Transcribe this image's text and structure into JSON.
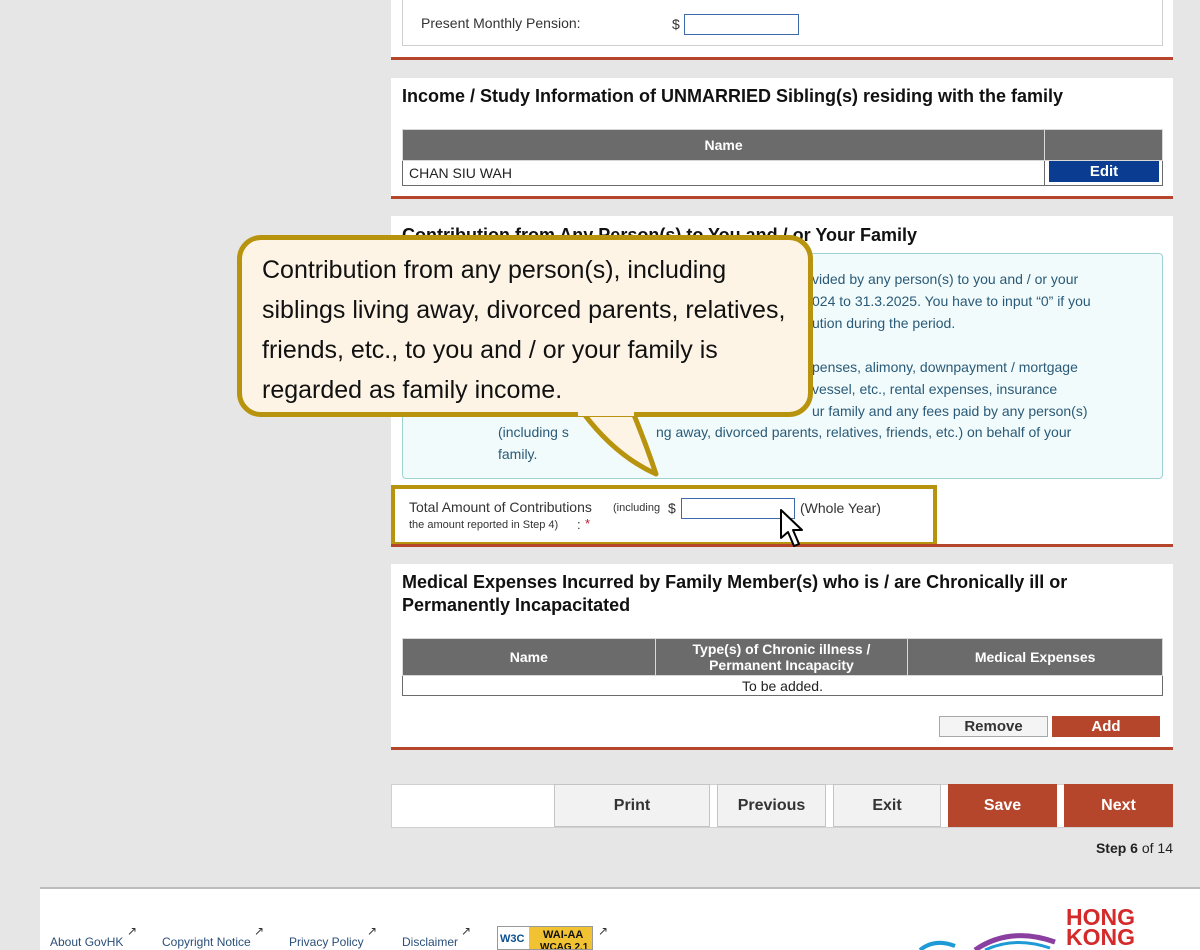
{
  "pension": {
    "label": "Present Monthly Pension:",
    "currency": "$",
    "value": ""
  },
  "siblings": {
    "title": "Income / Study Information of UNMARRIED Sibling(s) residing with the family",
    "col_name": "Name",
    "rows": [
      {
        "name": "CHAN SIU WAH",
        "edit_label": "Edit"
      }
    ]
  },
  "contribution": {
    "title": "Contribution from Any Person(s) to You and / or Your Family",
    "info_lines_right": [
      "vided by any person(s) to you and / or your",
      "024 to 31.3.2025. You have to input “0” if you",
      "ution during the period."
    ],
    "info_lines_right2": [
      "penses, alimony, downpayment / mortgage",
      " vessel, etc., rental expenses, insurance",
      "ur family and any fees paid by any person(s)"
    ],
    "info_line_a_left": "(including s",
    "info_line_a_right": "ng away, divorced parents, relatives, friends, etc.) on behalf of your",
    "info_line_b": "family.",
    "total_label": "Total Amount of Contributions",
    "total_note_1": "(including",
    "total_note_2": "the amount reported in Step 4)",
    "colon": ":",
    "required_mark": "*",
    "currency": "$",
    "value": "",
    "period": "(Whole Year)"
  },
  "callout": {
    "text": "Contribution from any person(s), including siblings living away, divorced parents, relatives, friends, etc., to you and / or your family is regarded as family income."
  },
  "medical": {
    "title_line1": "Medical Expenses Incurred by Family Member(s) who is / are Chronically ill or",
    "title_line2": "Permanently Incapacitated",
    "col_name": "Name",
    "col_type_1": "Type(s) of Chronic illness /",
    "col_type_2": "Permanent Incapacity",
    "col_expenses": "Medical Expenses",
    "empty_text": "To be added.",
    "remove_label": "Remove",
    "add_label": "Add"
  },
  "nav": {
    "print": "Print",
    "previous": "Previous",
    "exit": "Exit",
    "save": "Save",
    "next": "Next",
    "step_word": "Step",
    "step_current": "6",
    "step_of": "of 14"
  },
  "footer": {
    "links": [
      "About GovHK",
      "Copyright Notice",
      "Privacy Policy",
      "Disclaimer"
    ],
    "badge_left": "W3C",
    "badge_top": "WAI-AA",
    "badge_bottom": "WCAG 2.1",
    "brand_line1": "HONG",
    "brand_line2": "KONG"
  },
  "colors": {
    "accent_red": "#b5462c",
    "edit_blue": "#0a3d91",
    "highlight_gold": "#b8930d",
    "header_grey": "#6b6b6b"
  }
}
